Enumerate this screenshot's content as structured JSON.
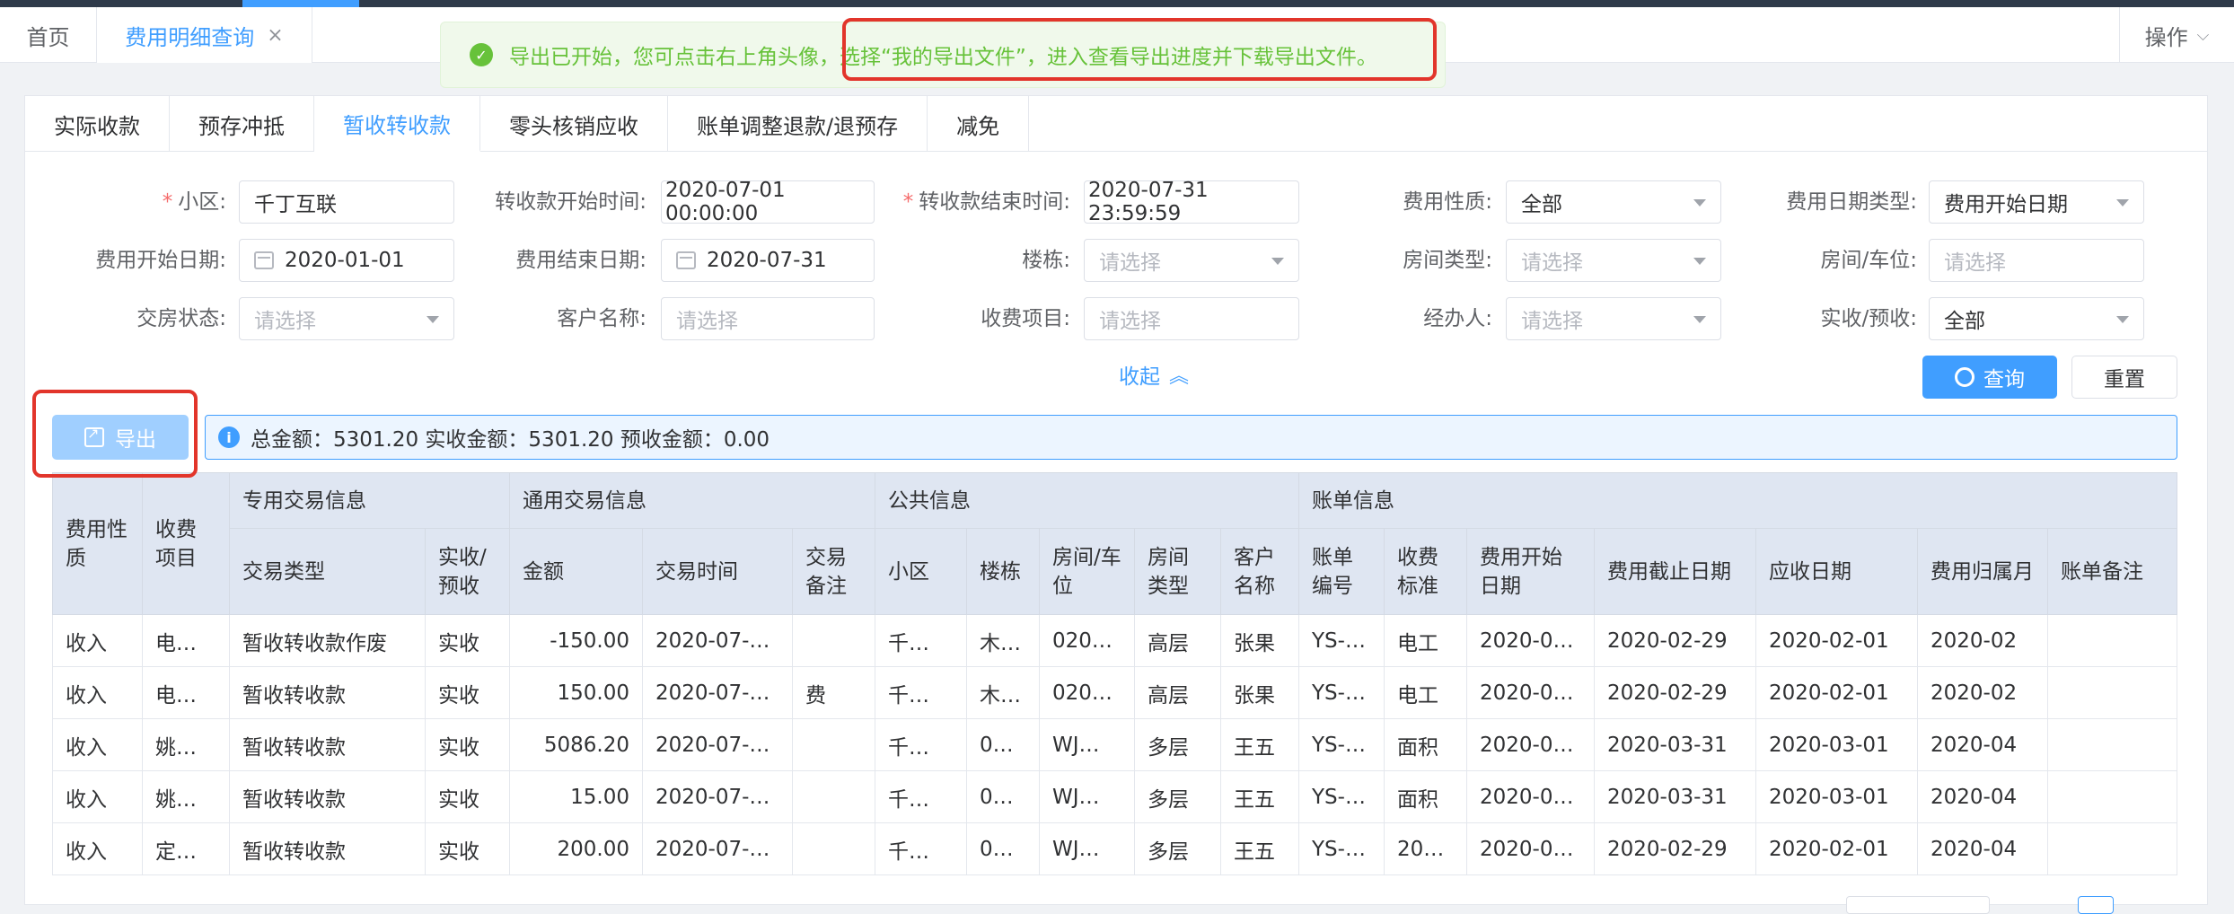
{
  "tabs": {
    "home": "首页",
    "active": "费用明细查询",
    "close": "×",
    "operations": "操作"
  },
  "toast": {
    "text_a": "导出已开始，您可点击右上角头像，",
    "text_b": "选择“我的导出文件”，进入查看导出进度并下载导出文件。"
  },
  "subtabs": [
    "实际收款",
    "预存冲抵",
    "暂收转收款",
    "零头核销应收",
    "账单调整退款/退预存",
    "减免"
  ],
  "filters": {
    "community": {
      "label": "小区:",
      "value": "千丁互联"
    },
    "transfer_start": {
      "label": "转收款开始时间:",
      "value": "2020-07-01 00:00:00"
    },
    "transfer_end": {
      "label": "转收款结束时间:",
      "value": "2020-07-31 23:59:59"
    },
    "fee_nature": {
      "label": "费用性质:",
      "value": "全部"
    },
    "fee_date_type": {
      "label": "费用日期类型:",
      "value": "费用开始日期"
    },
    "fee_start_date": {
      "label": "费用开始日期:",
      "value": "2020-01-01"
    },
    "fee_end_date": {
      "label": "费用结束日期:",
      "value": "2020-07-31"
    },
    "building": {
      "label": "楼栋:",
      "placeholder": "请选择"
    },
    "room_type": {
      "label": "房间类型:",
      "placeholder": "请选择"
    },
    "room_space": {
      "label": "房间/车位:",
      "placeholder": "请选择"
    },
    "handover_status": {
      "label": "交房状态:",
      "placeholder": "请选择"
    },
    "customer_name": {
      "label": "客户名称:",
      "placeholder": "请选择"
    },
    "charge_item": {
      "label": "收费项目:",
      "placeholder": "请选择"
    },
    "handler": {
      "label": "经办人:",
      "placeholder": "请选择"
    },
    "actual_prepay": {
      "label": "实收/预收:",
      "value": "全部"
    }
  },
  "actions": {
    "collapse": "收起",
    "query": "查询",
    "reset": "重置",
    "export": "导出"
  },
  "summary": "总金额：5301.20 实收金额：5301.20 预收金额：0.00",
  "table": {
    "groups": [
      "费用性质",
      "收费项目",
      "专用交易信息",
      "通用交易信息",
      "公共信息",
      "账单信息"
    ],
    "columns": [
      "交易类型",
      "实收/预收",
      "金额",
      "交易时间",
      "交易备注",
      "小区",
      "楼栋",
      "房间/车位",
      "房间类型",
      "客户名称",
      "账单编号",
      "收费标准",
      "费用开始日期",
      "费用截止日期",
      "应收日期",
      "费用归属月",
      "账单备注"
    ],
    "rows": [
      [
        "收入",
        "电…",
        "暂收转收款作废",
        "实收",
        "-150.00",
        "2020-07-…",
        "",
        "千…",
        "木…",
        "020…",
        "高层",
        "张果",
        "YS-…",
        "电工",
        "2020-0…",
        "2020-02-29",
        "2020-02-01",
        "2020-02",
        ""
      ],
      [
        "收入",
        "电…",
        "暂收转收款",
        "实收",
        "150.00",
        "2020-07-…",
        "费",
        "千…",
        "木…",
        "020…",
        "高层",
        "张果",
        "YS-…",
        "电工",
        "2020-0…",
        "2020-02-29",
        "2020-02-01",
        "2020-02",
        ""
      ],
      [
        "收入",
        "姚…",
        "暂收转收款",
        "实收",
        "5086.20",
        "2020-07-…",
        "",
        "千…",
        "0…",
        "WJ…",
        "多层",
        "王五",
        "YS-…",
        "面积",
        "2020-0…",
        "2020-03-31",
        "2020-03-01",
        "2020-04",
        ""
      ],
      [
        "收入",
        "姚…",
        "暂收转收款",
        "实收",
        "15.00",
        "2020-07-…",
        "",
        "千…",
        "0…",
        "WJ…",
        "多层",
        "王五",
        "YS-…",
        "面积",
        "2020-0…",
        "2020-03-31",
        "2020-03-01",
        "2020-04",
        ""
      ],
      [
        "收入",
        "定…",
        "暂收转收款",
        "实收",
        "200.00",
        "2020-07-…",
        "",
        "千…",
        "0…",
        "WJ…",
        "多层",
        "王五",
        "YS-…",
        "20…",
        "2020-0…",
        "2020-02-29",
        "2020-02-01",
        "2020-04",
        ""
      ]
    ]
  },
  "colors": {
    "primary": "#409eff",
    "success": "#67c23a",
    "highlight_box": "#e2352b",
    "header_bg": "#dfe6f2"
  }
}
